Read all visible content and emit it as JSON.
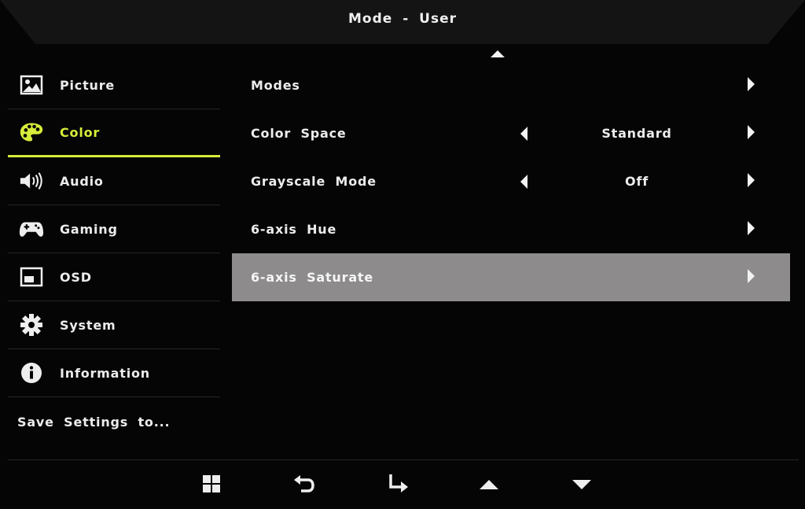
{
  "header": {
    "title": "Mode - User"
  },
  "sidebar": {
    "items": [
      {
        "label": "Picture",
        "icon": "picture-icon"
      },
      {
        "label": "Color",
        "icon": "palette-icon",
        "active": true
      },
      {
        "label": "Audio",
        "icon": "speaker-icon"
      },
      {
        "label": "Gaming",
        "icon": "gamepad-icon"
      },
      {
        "label": "OSD",
        "icon": "osd-window-icon"
      },
      {
        "label": "System",
        "icon": "gear-icon"
      },
      {
        "label": "Information",
        "icon": "info-icon"
      }
    ],
    "save_label": "Save Settings to..."
  },
  "content": {
    "rows": [
      {
        "label": "Modes",
        "value": ""
      },
      {
        "label": "Color Space",
        "value": "Standard"
      },
      {
        "label": "Grayscale Mode",
        "value": "Off"
      },
      {
        "label": "6-axis Hue",
        "value": ""
      },
      {
        "label": "6-axis Saturate",
        "value": "",
        "selected": true
      }
    ]
  },
  "bottom_bar": {
    "buttons": [
      "menu-grid-icon",
      "back-icon",
      "enter-icon",
      "up-arrow-icon",
      "down-arrow-icon"
    ]
  },
  "colors": {
    "accent": "#d7ec3a",
    "selected_row": "#8d8b8b",
    "background": "#050505",
    "text": "#ececec"
  }
}
